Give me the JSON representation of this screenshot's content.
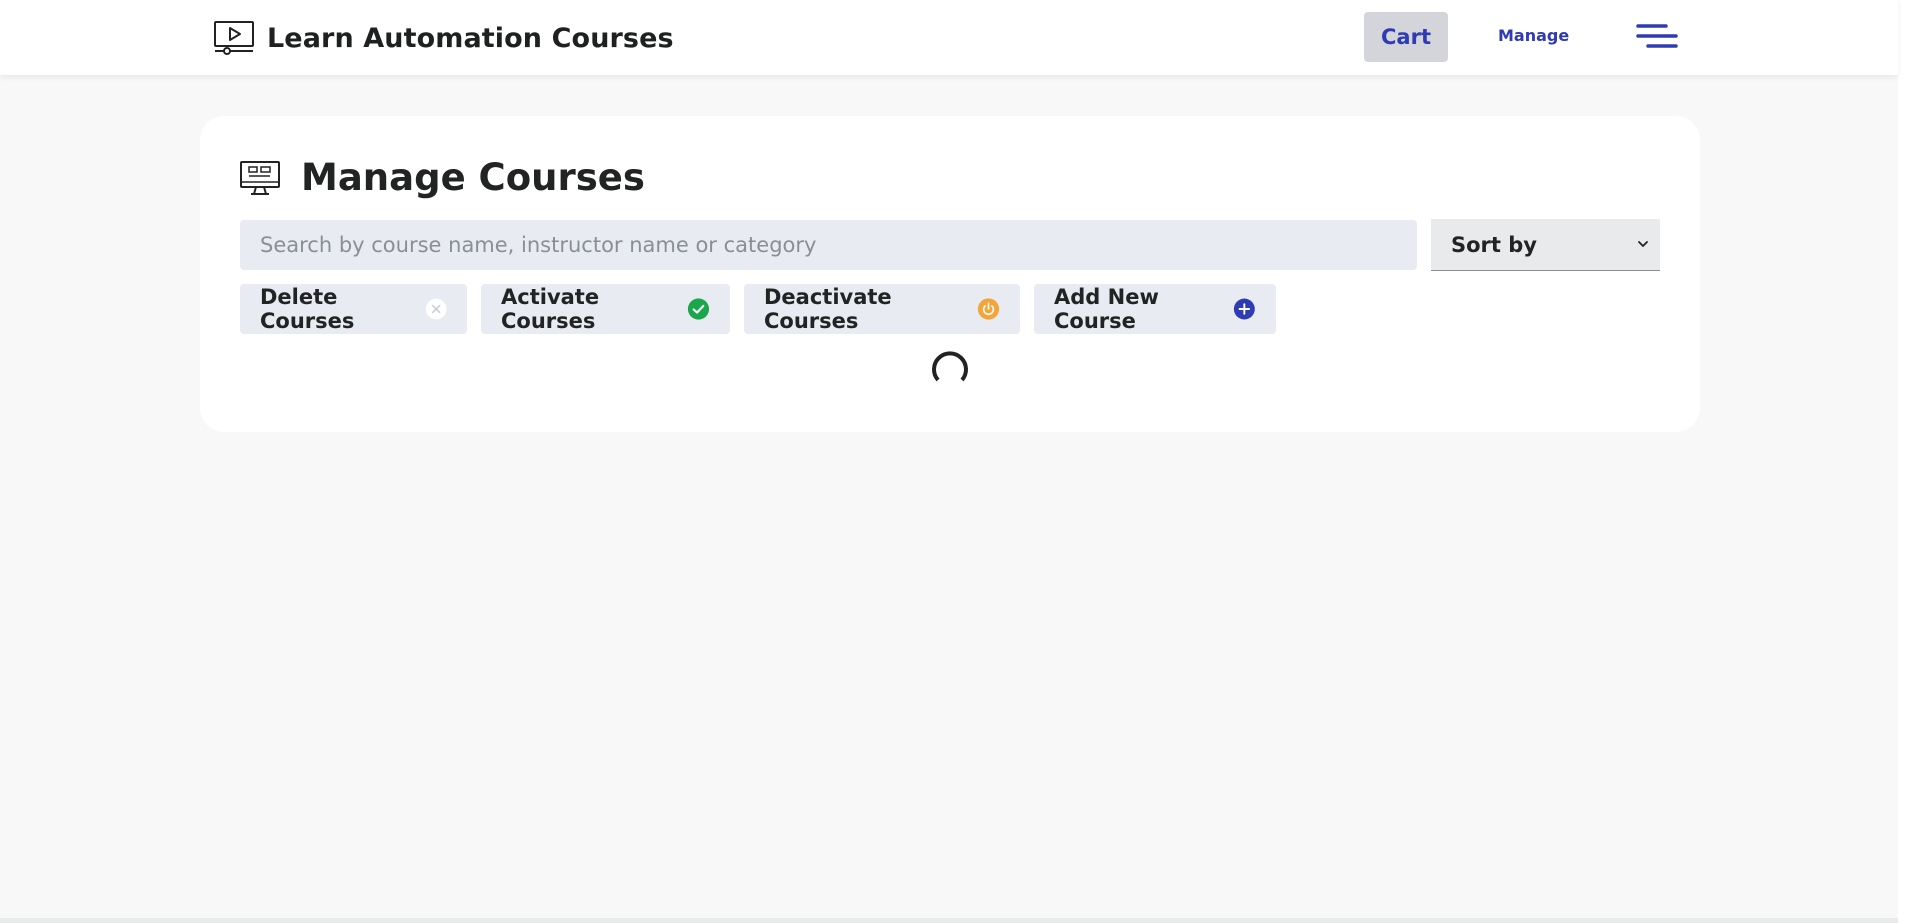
{
  "header": {
    "brand_title": "Learn Automation Courses",
    "cart_label": "Cart",
    "manage_label": "Manage"
  },
  "page": {
    "title": "Manage Courses",
    "search_placeholder": "Search by course name, instructor name or category",
    "sort_label": "Sort by"
  },
  "actions": [
    {
      "label": "Delete Courses",
      "icon": "close-circle-icon",
      "color": "#ffffff"
    },
    {
      "label": "Activate Courses",
      "icon": "check-circle-icon",
      "color": "#1aa64a"
    },
    {
      "label": "Deactivate Courses",
      "icon": "power-circle-icon",
      "color": "#f4a53a"
    },
    {
      "label": "Add New Course",
      "icon": "plus-circle-icon",
      "color": "#2f3bb3"
    }
  ],
  "colors": {
    "accent": "#2f3bb3",
    "page_background": "#f7f8f7",
    "button_background": "#e8ebf2",
    "cart_background": "#d4d4db"
  }
}
